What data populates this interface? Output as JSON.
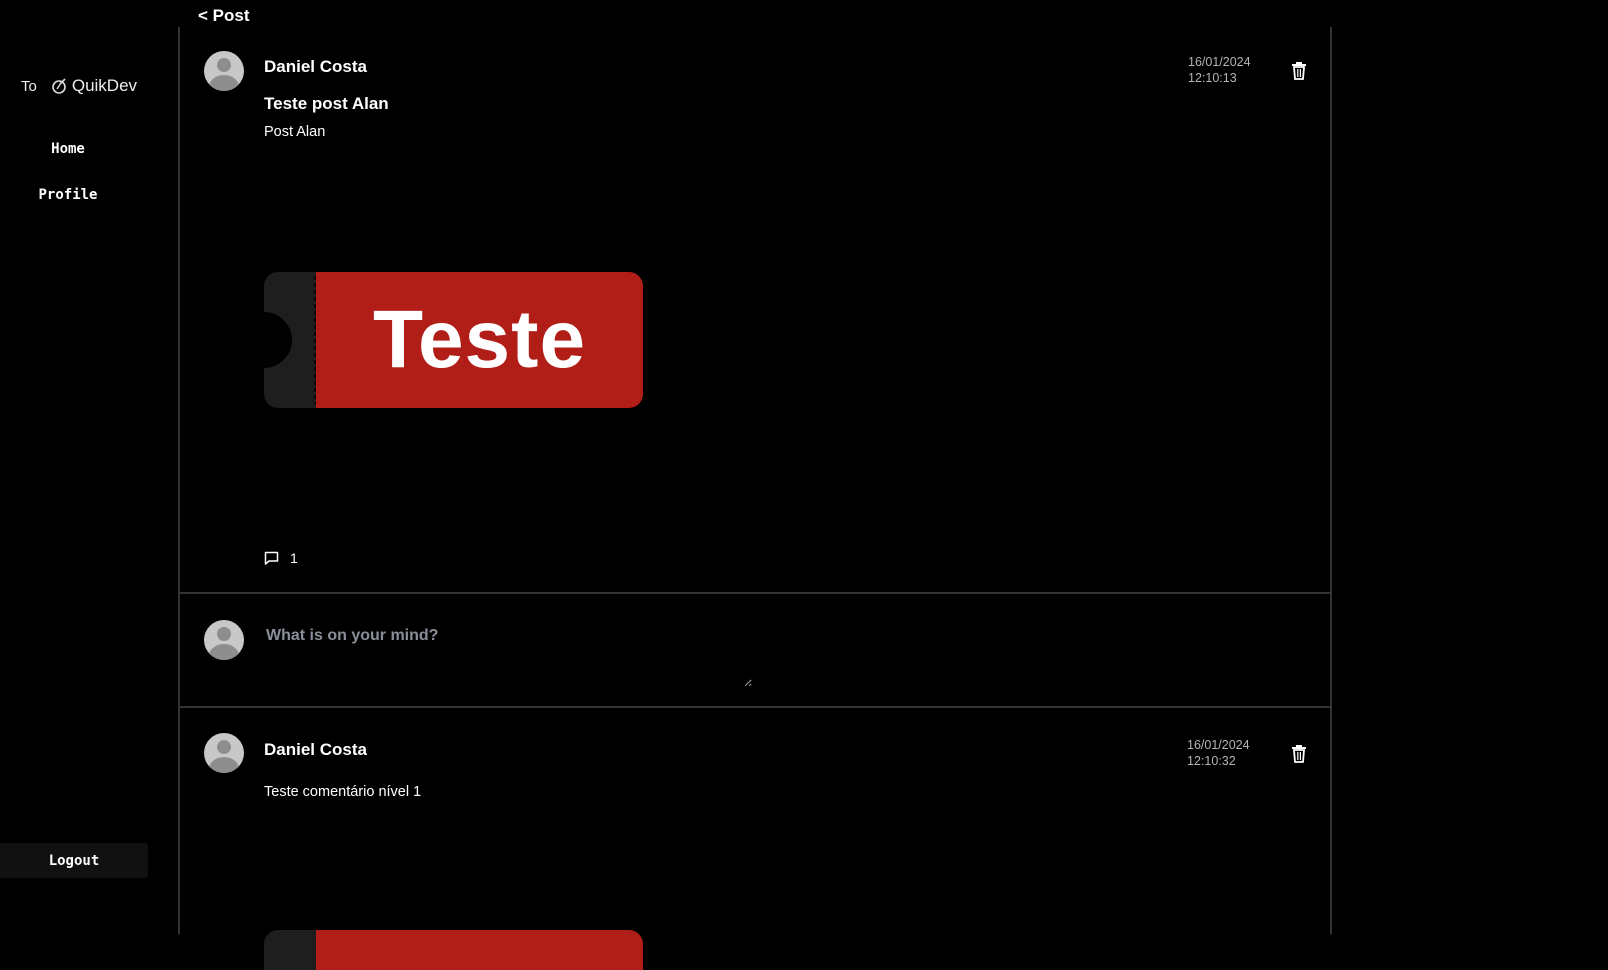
{
  "header": {
    "back_label": "< Post"
  },
  "sidebar": {
    "brand_prefix": "To",
    "brand_icon": "quikdev-logo-icon",
    "brand_name": "QuikDev",
    "items": [
      {
        "label": "Home"
      },
      {
        "label": "Profile"
      }
    ],
    "logout_label": "Logout"
  },
  "post": {
    "author": "Daniel Costa",
    "date": "16/01/2024",
    "time": "12:10:13",
    "title": "Teste post Alan",
    "body": "Post Alan",
    "image_text": "Teste",
    "comment_count": "1",
    "colors": {
      "ticket_red": "#b01e17",
      "ticket_stub": "#1e1e1e"
    }
  },
  "compose": {
    "placeholder": "What is on your mind?"
  },
  "comments": [
    {
      "author": "Daniel Costa",
      "date": "16/01/2024",
      "time": "12:10:32",
      "body": "Teste comentário nível 1"
    }
  ]
}
